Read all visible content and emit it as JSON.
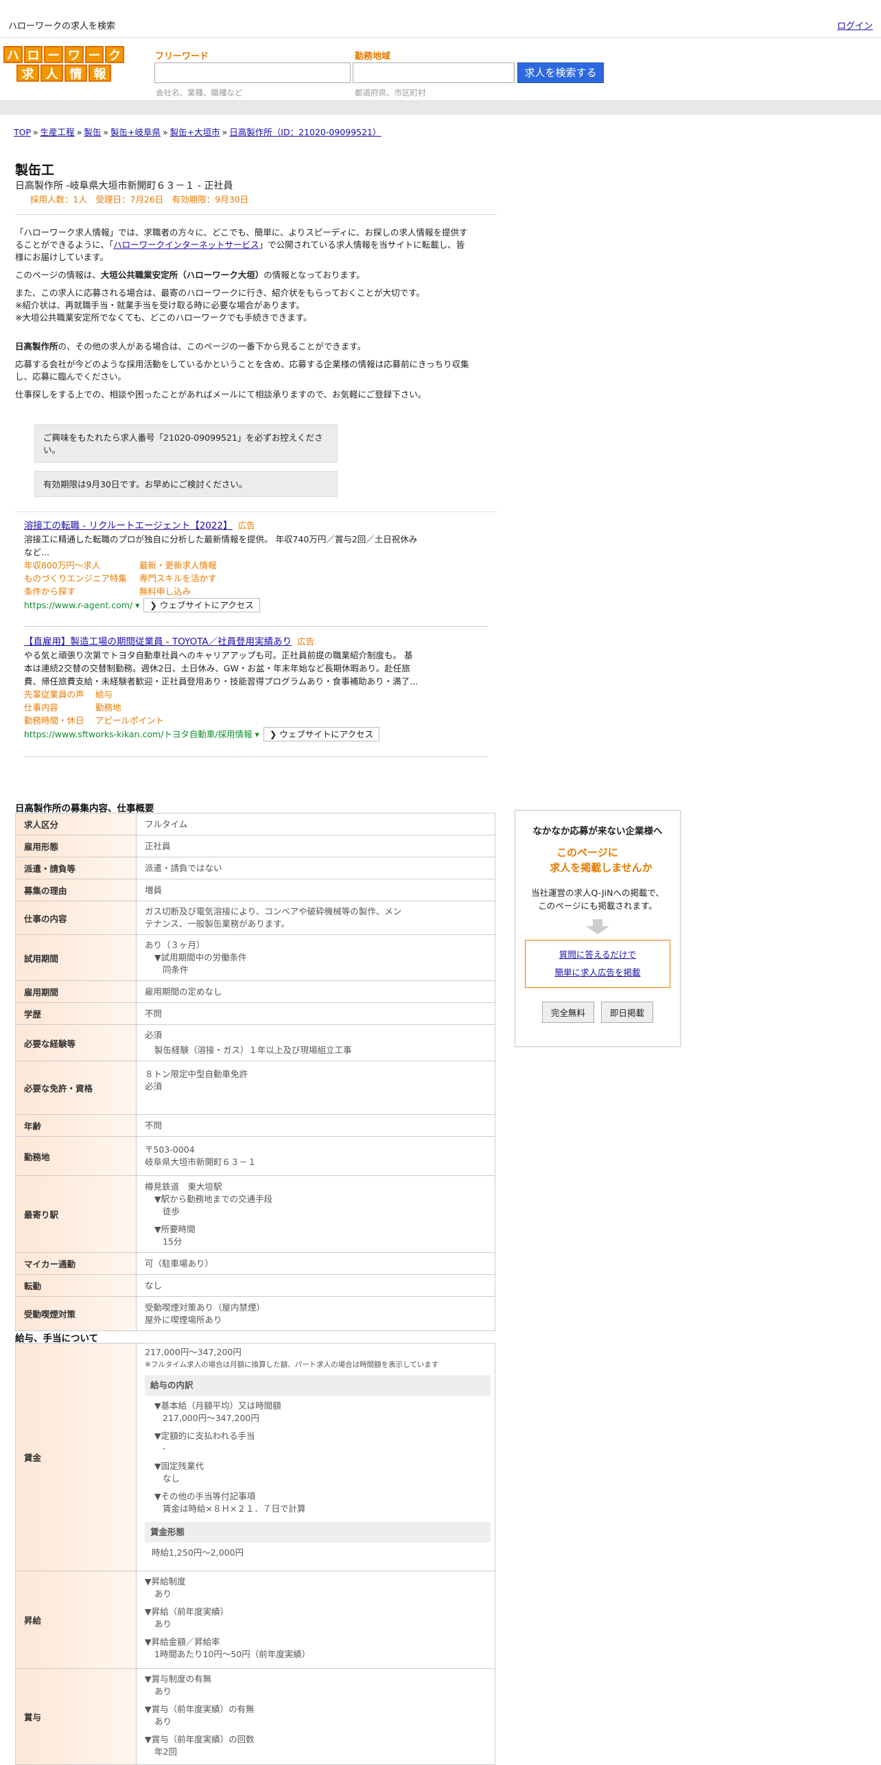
{
  "header": {
    "site_title": "ハローワークの求人を検索",
    "login": "ログイン"
  },
  "logo": {
    "row1": [
      "ハ",
      "ロ",
      "ー",
      "ワ",
      "ー",
      "ク"
    ],
    "row2": [
      "求",
      "人",
      "情",
      "報"
    ]
  },
  "search": {
    "freeword_label": "フリーワード",
    "freeword_hint": "会社名、業種、職種など",
    "area_label": "勤務地域",
    "area_hint": "都道府県、市区町村",
    "button": "求人を検索する"
  },
  "breadcrumb": [
    "TOP",
    "生産工程",
    "製缶",
    "製缶+岐阜県",
    "製缶+大垣市",
    "日高製作所（ID：21020-09099521）"
  ],
  "job": {
    "title": "製缶工",
    "company_line": "日高製作所 -岐阜県大垣市新開町６３－１ - 正社員",
    "meta": "採用人数：1人　受理日：7月26日　有効期限：9月30日"
  },
  "intro": {
    "p1a": "「ハローワーク求人情報」では、求職者の方々に、どこでも、簡単に、よりスピーディに、お探しの求人情報を提供す",
    "p1b": "ることができるように、「",
    "p1link": "ハローワークインターネットサービス",
    "p1c": "」で公開されている求人情報を当サイトに転載し、皆",
    "p1d": "様にお届けしています。",
    "p2a": "このページの情報は、",
    "p2b": "大垣公共職業安定所（ハローワーク大垣）",
    "p2c": "の情報となっております。",
    "p3": "また、この求人に応募される場合は、最寄のハローワークに行き、紹介状をもらっておくことが大切です。",
    "p4": "※紹介状は、再就職手当・就業手当を受け取る時に必要な場合があります。",
    "p5": "※大垣公共職業安定所でなくても、どこのハローワークでも手続きできます。",
    "p6a": "日高製作所",
    "p6b": "の、その他の求人がある場合は、このページの一番下から見ることができます。",
    "p7a": "応募する会社が今どのような採用活動をしているかということを含め、応募する企業様の情報は応募前にきっちり収集",
    "p7b": "し、応募に臨んでください。",
    "p8": "仕事探しをする上での、相談や困ったことがあればメールにて相談承りますので、お気軽にご登録下さい。"
  },
  "notes": {
    "n1a": "ご興味をもたれたら求人番号「21020-09099521」を必ずお控えくださ",
    "n1b": "い。",
    "n2": "有効期限は9月30日です。お早めにご検討ください。"
  },
  "ads": [
    {
      "title": "溶接工の転職 - リクルートエージェント【2022】",
      "tag": "広告",
      "desc1": "溶接工に精通した転職のプロが独自に分析した最新情報を提供。 年収740万円／賞与2回／土日祝休み",
      "desc2": "など...",
      "links": [
        [
          "年収800万円～求人",
          "最新・更新求人情報"
        ],
        [
          "ものづくりエンジニア特集",
          "専門スキルを活かす"
        ],
        [
          "条件から探す",
          "無料申し込み"
        ]
      ],
      "url": "https://www.r-agent.com/",
      "button": "❯ ウェブサイトにアクセス"
    },
    {
      "title": "【直雇用】製造工場の期間従業員 - TOYOTA／社員登用実績あり",
      "tag": "広告",
      "desc1": "やる気と頑張り次第でトヨタ自動車社員へのキャリアアップも可。正社員前提の職業紹介制度も。 基",
      "desc2": "本は連続2交替の交替制勤務。週休2日、土日休み、GW・お盆・年末年始など長期休暇あり。赴任旅",
      "desc3": "費、帰任旅費支給・未経験者歓迎・正社員登用あり・技能習得プログラムあり・食事補助あり・満了...",
      "links": [
        [
          "先輩従業員の声",
          "給与"
        ],
        [
          "仕事内容",
          "勤務地"
        ],
        [
          "勤務時間・休日",
          "アピールポイント"
        ]
      ],
      "url": "https://www.sftworks-kikan.com/トヨタ自動車/採用情報",
      "button": "❯ ウェブサイトにアクセス"
    }
  ],
  "section1": {
    "heading": "日高製作所の募集内容、仕事概要",
    "rows": [
      {
        "k": "求人区分",
        "v": [
          "フルタイム"
        ]
      },
      {
        "k": "雇用形態",
        "v": [
          "正社員"
        ]
      },
      {
        "k": "派遣・請負等",
        "v": [
          "派遣・請負ではない"
        ]
      },
      {
        "k": "募集の理由",
        "v": [
          "増員"
        ]
      },
      {
        "k": "仕事の内容",
        "v": [
          "ガス切断及び電気溶接により、コンベアや破砕機械等の製作、メン",
          "テナンス、一般製缶業務があります。"
        ]
      },
      {
        "k": "試用期間",
        "v": [
          "あり（３ヶ月）",
          "▼試用期間中の労働条件",
          "同条件"
        ]
      },
      {
        "k": "雇用期間",
        "v": [
          "雇用期間の定めなし"
        ]
      },
      {
        "k": "学歴",
        "v": [
          "不問"
        ]
      },
      {
        "k": "必要な経験等",
        "v": [
          "必須",
          "製缶経験（溶接・ガス）１年以上及び現場組立工事"
        ]
      },
      {
        "k": "必要な免許・資格",
        "v": [
          "８トン限定中型自動車免許",
          "必須"
        ]
      },
      {
        "k": "年齢",
        "v": [
          "不問"
        ]
      },
      {
        "k": "勤務地",
        "v": [
          "〒503-0004",
          "岐阜県大垣市新開町６３－１"
        ]
      },
      {
        "k": "最寄り駅",
        "v": [
          "樽見鉄道　東大垣駅",
          "▼駅から勤務地までの交通手段",
          "徒歩",
          "▼所要時間",
          "15分"
        ]
      },
      {
        "k": "マイカー通勤",
        "v": [
          "可（駐車場あり）"
        ]
      },
      {
        "k": "転勤",
        "v": [
          "なし"
        ]
      },
      {
        "k": "受動喫煙対策",
        "v": [
          "受動喫煙対策あり（屋内禁煙）",
          "屋外に喫煙場所あり"
        ]
      }
    ]
  },
  "section2": {
    "heading": "給与、手当について",
    "wage_k": "賃金",
    "wage_range": "217,000円〜347,200円",
    "wage_note": "※フルタイム求人の場合は月額に換算した額、パート求人の場合は時間額を表示しています",
    "breakdown_h": "給与の内訳",
    "b1": "▼基本給（月額平均）又は時間額",
    "b1v": "217,000円〜347,200円",
    "b2": "▼定額的に支払われる手当",
    "b2v": "-",
    "b3": "▼固定残業代",
    "b3v": "なし",
    "b4": "▼その他の手当等付記事項",
    "b4v": "賃金は時給×８Ｈ×２１．７日で計算",
    "form_h": "賃金形態",
    "form_v": "時給1,250円〜2,000円",
    "raise_k": "昇給",
    "r1": "▼昇給制度",
    "r1v": "あり",
    "r2": "▼昇給（前年度実績）",
    "r2v": "あり",
    "r3": "▼昇給金額／昇給率",
    "r3v": "1時間あたり10円〜50円（前年度実績）",
    "bonus_k": "賞与",
    "s1": "▼賞与制度の有無",
    "s1v": "あり",
    "s2": "▼賞与（前年度実績）の有無",
    "s2v": "あり",
    "s3": "▼賞与（前年度実績）の回数",
    "s3v": "年2回"
  },
  "sidebar": {
    "heading": "なかなか応募が来ない企業様へ",
    "orange1": "このページに",
    "orange2": "求人を掲載しませんか",
    "body1": "当社運営の求人Q-JiNへの掲載で、",
    "body2": "このページにも掲載されます。",
    "link1": "質問に答えるだけで",
    "link2": "簡単に求人広告を掲載",
    "btn1": "完全無料",
    "btn2": "即日掲載"
  }
}
